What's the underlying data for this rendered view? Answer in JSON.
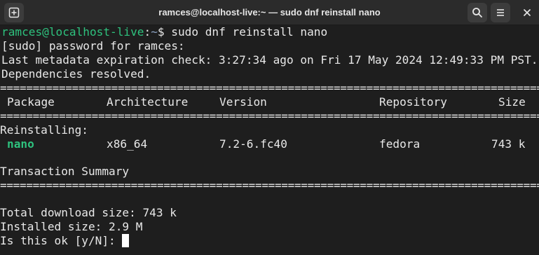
{
  "window": {
    "title": "ramces@localhost-live:~ — sudo dnf reinstall nano",
    "icons": {
      "new_tab": "new-tab-icon",
      "search": "search-icon",
      "menu": "hamburger-menu-icon",
      "close": "close-icon"
    }
  },
  "terminal": {
    "prompt": {
      "user_host": "ramces@localhost-live",
      "separator": ":",
      "path": "~",
      "symbol": "$",
      "command": "sudo dnf reinstall nano"
    },
    "sudo_line": "[sudo] password for ramces:",
    "metadata_line": "Last metadata expiration check: 3:27:34 ago on Fri 17 May 2024 12:49:33 PM PST.",
    "deps_line": "Dependencies resolved.",
    "separator_line": "================================================================================================================================",
    "table": {
      "headers": [
        "Package",
        "Architecture",
        "Version",
        "Repository",
        "Size"
      ],
      "section": "Reinstalling:",
      "rows": [
        {
          "package": "nano",
          "arch": "x86_64",
          "version": "7.2-6.fc40",
          "repo": "fedora",
          "size": "743 k"
        }
      ]
    },
    "summary_title": "Transaction Summary",
    "total_download": "Total download size: 743 k",
    "installed_size": "Installed size: 2.9 M",
    "confirm_prompt": "Is this ok [y/N]: "
  },
  "colors": {
    "background": "#1e1e1e",
    "titlebar": "#2b2b2b",
    "text": "#e8e8e8",
    "green": "#2ec27e",
    "path_blue": "#8ea4c4"
  }
}
